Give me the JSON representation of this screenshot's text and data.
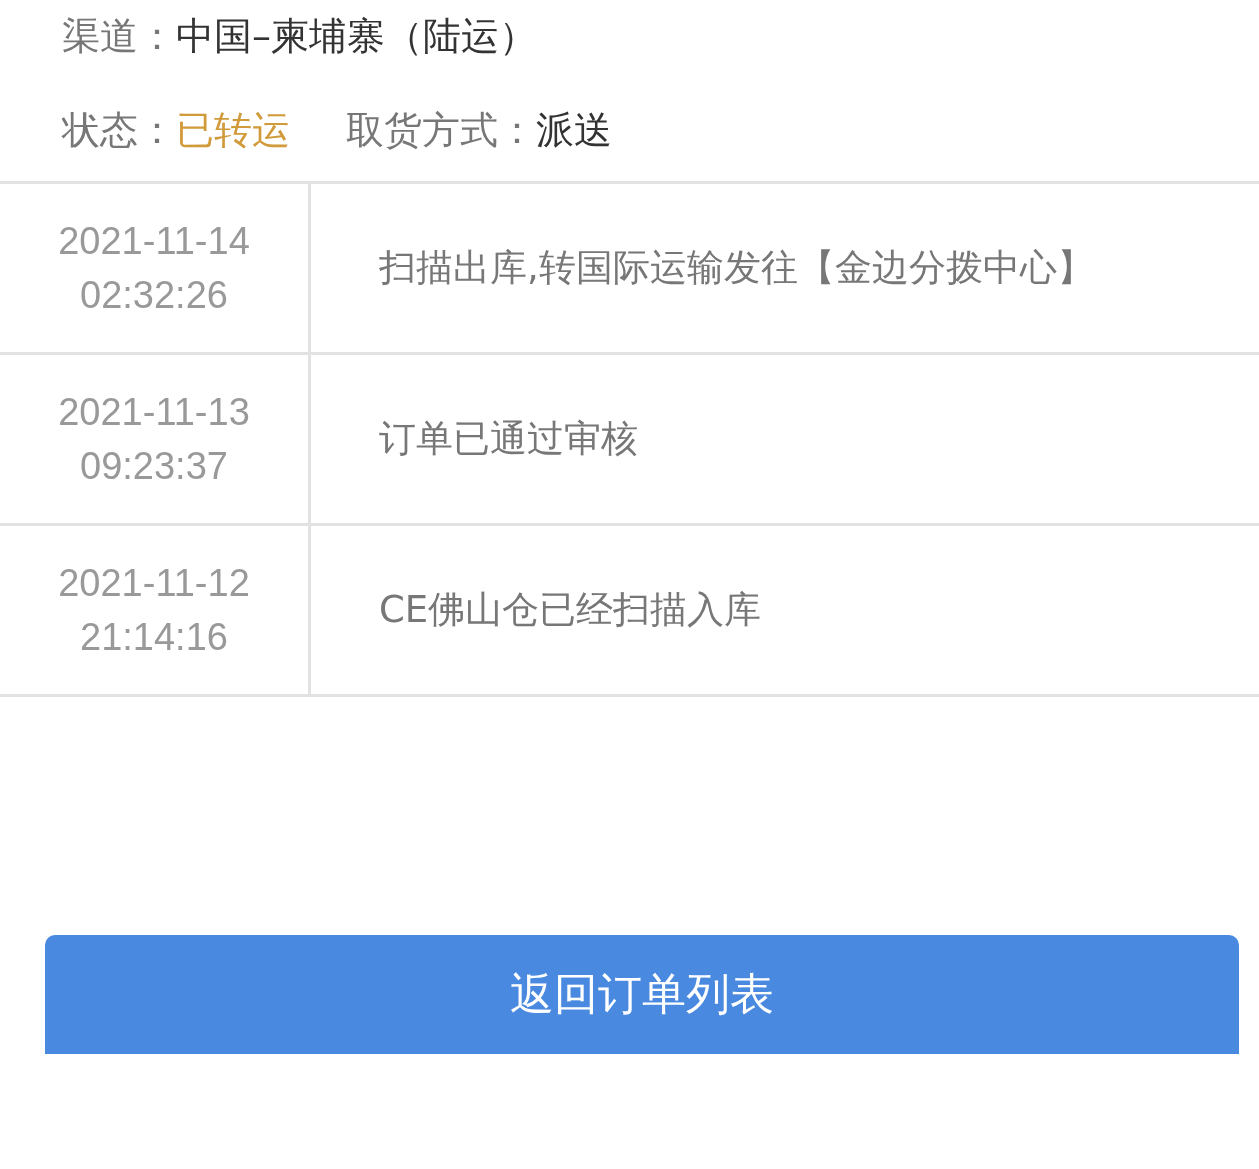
{
  "channel": {
    "label": "渠道：",
    "value": "中国–柬埔寨（陆运）"
  },
  "status": {
    "label": "状态：",
    "value": "已转运"
  },
  "pickup": {
    "label": "取货方式：",
    "value": "派送"
  },
  "tracking": [
    {
      "date": "2021-11-14",
      "time": "02:32:26",
      "event": "扫描出库,转国际运输发往【金边分拨中心】"
    },
    {
      "date": "2021-11-13",
      "time": "09:23:37",
      "event": "订单已通过审核"
    },
    {
      "date": "2021-11-12",
      "time": "21:14:16",
      "event": "CE佛山仓已经扫描入库"
    }
  ],
  "back_button": "返回订单列表"
}
